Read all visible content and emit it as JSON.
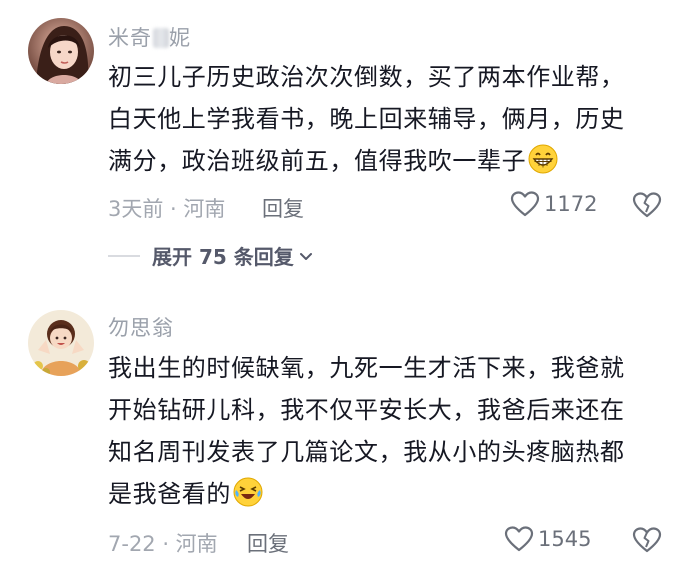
{
  "comments": [
    {
      "username": "米奇",
      "username_hidden_char": "米",
      "username_tail": "妮",
      "lines": [
        "初三儿子历史政治次次倒数，买了两本作业帮，",
        "白天他上学我看书，晚上回来辅导，俩月，历史",
        "满分，政治班级前五，值得我吹一辈子"
      ],
      "emoji": "grin-emoji",
      "time_location": "3天前 · 河南",
      "reply_label": "回复",
      "likes": "1172",
      "expand_label": "展开 75 条回复"
    },
    {
      "username": "勿思翁",
      "lines": [
        "我出生的时候缺氧，九死一生才活下来，我爸就",
        "开始钻研儿科，我不仅平安长大，我爸后来还在",
        "知名周刊发表了几篇论文，我从小的头疼脑热都",
        "是我爸看的"
      ],
      "emoji": "laugh-cry-emoji",
      "time_location": "7-22 · 河南",
      "reply_label": "回复",
      "likes": "1545"
    }
  ],
  "colors": {
    "text": "#161823",
    "meta": "#a2a7b0",
    "action": "#6b707a"
  }
}
